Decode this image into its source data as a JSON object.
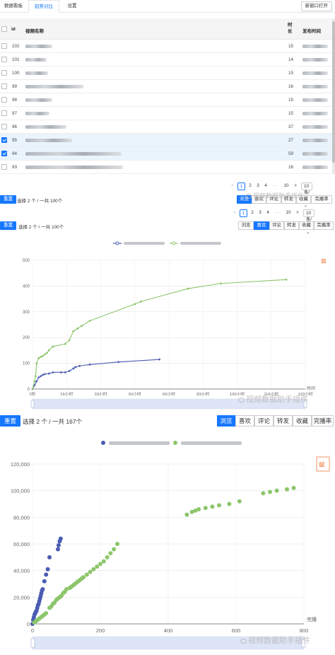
{
  "tabs": [
    {
      "label": "数据看板",
      "active": false
    },
    {
      "label": "趋势对比",
      "active": true
    },
    {
      "label": "设置",
      "active": false
    }
  ],
  "open_new_window": "新窗口打开",
  "table": {
    "headers": {
      "id": "id",
      "name": "视频名称",
      "duration": "时长",
      "publish": "发布时间"
    },
    "rows": [
      {
        "id": "102",
        "duration": "15",
        "selected": false
      },
      {
        "id": "101",
        "duration": "14",
        "selected": false
      },
      {
        "id": "100",
        "duration": "15",
        "selected": false
      },
      {
        "id": "99",
        "duration": "16",
        "selected": false
      },
      {
        "id": "98",
        "duration": "15",
        "selected": false
      },
      {
        "id": "97",
        "duration": "15",
        "selected": false
      },
      {
        "id": "96",
        "duration": "37",
        "selected": false
      },
      {
        "id": "95",
        "duration": "27",
        "selected": true
      },
      {
        "id": "94",
        "duration": "59",
        "selected": true
      },
      {
        "id": "93",
        "duration": "16",
        "selected": false
      }
    ]
  },
  "pagination": {
    "prev": "<",
    "pages": [
      "1",
      "2",
      "3",
      "4",
      "···",
      "10"
    ],
    "current": "1",
    "next": ">",
    "page_size": "10 条/页"
  },
  "metrics": [
    "浏览",
    "喜欢",
    "评论",
    "转发",
    "收藏",
    "完播率"
  ],
  "panel_top": {
    "reset": "重置",
    "selection": "选择 2 个 / 一共 100个",
    "active_metric": "浏览"
  },
  "panel_mid": {
    "reset": "重置",
    "selection": "选择 2 个 / 一共 100个",
    "active_metric": "喜欢"
  },
  "panel_bottom": {
    "reset": "重置",
    "selection": "选择 2 个 / 一共 167个",
    "active_metric": "浏览"
  },
  "watermark": "视频数据助手插件",
  "colors": {
    "blue": "#4a5cb3",
    "green": "#8cc66b",
    "accent": "#1677ff",
    "orange": "#f07b3f"
  },
  "chart_data": [
    {
      "type": "line",
      "xlabel": "时间",
      "ylim": [
        0,
        500
      ],
      "yticks": [
        "0",
        "100",
        "200",
        "300",
        "400",
        "500"
      ],
      "xticks": [
        "0秒",
        "16小时",
        "33小时",
        "50小时",
        "66小时",
        "83小时",
        "100小时",
        "116小时",
        "133小时"
      ],
      "series": [
        {
          "color": "#4a5cb3",
          "x": [
            0,
            1,
            2,
            3,
            4,
            5,
            6,
            8,
            10,
            14,
            16,
            18,
            20,
            21,
            23,
            28,
            42,
            62
          ],
          "y": [
            0,
            15,
            30,
            45,
            50,
            55,
            58,
            60,
            65,
            65,
            65,
            70,
            80,
            85,
            90,
            95,
            105,
            115
          ]
        },
        {
          "color": "#8cc66b",
          "x": [
            0,
            1,
            1.5,
            2,
            3,
            4,
            5,
            6,
            7,
            8,
            10,
            16,
            18,
            20,
            22,
            24,
            28,
            50,
            53,
            76,
            92,
            124
          ],
          "y": [
            0,
            30,
            50,
            100,
            120,
            125,
            128,
            135,
            140,
            150,
            165,
            175,
            190,
            225,
            235,
            245,
            265,
            330,
            340,
            390,
            410,
            425
          ]
        }
      ]
    },
    {
      "type": "scatter",
      "xlabel": "完播",
      "ylim": [
        0,
        120000
      ],
      "xlim": [
        0,
        800
      ],
      "yticks": [
        "0",
        "20,000",
        "40,000",
        "60,000",
        "80,000",
        "100,000",
        "120,000"
      ],
      "xticks": [
        "0",
        "200",
        "400",
        "600",
        "800"
      ],
      "series": [
        {
          "color": "#4a5cb3",
          "x": [
            0,
            2,
            4,
            6,
            8,
            10,
            12,
            14,
            16,
            18,
            20,
            22,
            24,
            26,
            28,
            30,
            35,
            40,
            45,
            50,
            75,
            77,
            80,
            83
          ],
          "y": [
            0,
            3000,
            5000,
            7000,
            8000,
            9000,
            10000,
            12000,
            14000,
            15000,
            17000,
            19000,
            21000,
            23000,
            25000,
            26000,
            32000,
            37000,
            41000,
            50000,
            56000,
            59000,
            62000,
            64000
          ]
        },
        {
          "color": "#8cc66b",
          "x": [
            5,
            10,
            15,
            20,
            25,
            30,
            35,
            40,
            50,
            55,
            60,
            65,
            70,
            75,
            80,
            85,
            90,
            95,
            100,
            110,
            115,
            120,
            125,
            130,
            135,
            140,
            145,
            150,
            160,
            170,
            180,
            190,
            200,
            210,
            220,
            230,
            240,
            250,
            455,
            470,
            480,
            490,
            510,
            530,
            550,
            580,
            610,
            680,
            700,
            720,
            750,
            770
          ],
          "y": [
            1000,
            2000,
            3000,
            4000,
            5000,
            6000,
            7000,
            8000,
            12000,
            13000,
            15000,
            16000,
            18000,
            19000,
            20000,
            21000,
            23000,
            24000,
            26000,
            27000,
            28000,
            29000,
            30000,
            31000,
            32000,
            33000,
            34000,
            35000,
            37000,
            39000,
            41000,
            43000,
            45000,
            47000,
            50000,
            53000,
            56000,
            60000,
            82000,
            84000,
            85000,
            86000,
            87000,
            88000,
            89000,
            90000,
            92000,
            98000,
            99000,
            100000,
            101000,
            102000
          ]
        }
      ]
    }
  ]
}
